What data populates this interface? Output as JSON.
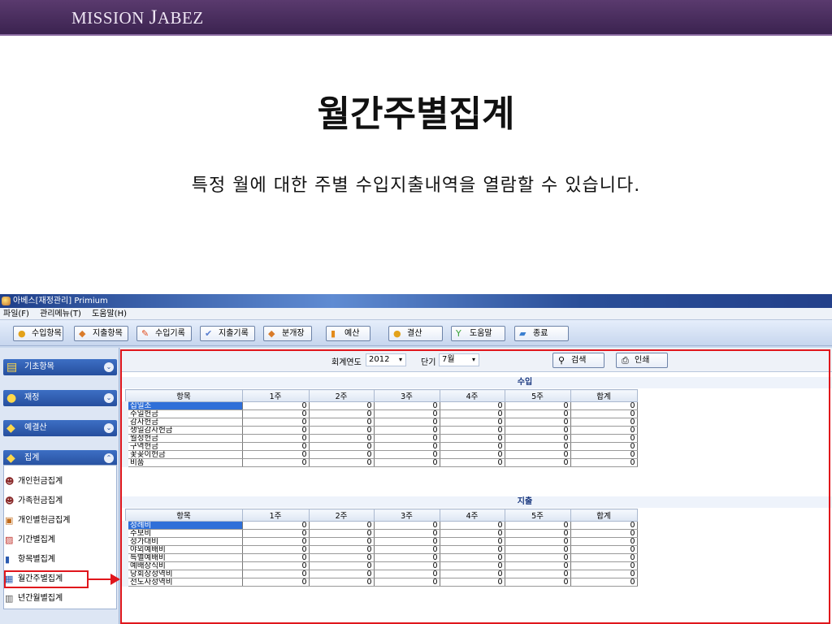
{
  "slide": {
    "brand_first": "MISSION ",
    "brand_second": "J",
    "brand_rest": "ABEZ",
    "title": "월간주별집계",
    "subtitle": "특정 월에 대한 주별 수입지출내역을 열람할 수 있습니다."
  },
  "app": {
    "title": "아베스[재정관리]  Primium",
    "menu": [
      "파일(F)",
      "관리메뉴(T)",
      "도움말(H)"
    ],
    "toolbar": [
      {
        "label": "수입항목",
        "icon": "coins-icon"
      },
      {
        "label": "지출항목",
        "icon": "diamond-icon"
      },
      {
        "label": "수입기록",
        "icon": "pencil-icon"
      },
      {
        "label": "지출기록",
        "icon": "checkmark-icon"
      },
      {
        "label": "분개장",
        "icon": "diamond-icon"
      },
      {
        "label": "예산",
        "icon": "bar-chart-icon"
      },
      {
        "label": "결산",
        "icon": "coins-icon"
      },
      {
        "label": "도움말",
        "icon": "sprout-icon"
      },
      {
        "label": "종료",
        "icon": "exit-icon"
      }
    ],
    "sidebar": {
      "headers": [
        {
          "label": "기초항목"
        },
        {
          "label": "재정"
        },
        {
          "label": "예결산"
        },
        {
          "label": "집계"
        }
      ],
      "items": [
        {
          "label": "개인헌금집계"
        },
        {
          "label": "가족헌금집계"
        },
        {
          "label": "개인별헌금집계"
        },
        {
          "label": "기간별집계"
        },
        {
          "label": "항목별집계"
        },
        {
          "label": "월간주별집계"
        },
        {
          "label": "년간월별집계"
        }
      ]
    },
    "filter": {
      "year_label": "회계연도",
      "year_value": "2012",
      "month_label": "단기",
      "month_value": "7월",
      "search_label": "검색",
      "print_label": "인쇄"
    },
    "income": {
      "title": "수입",
      "headers": [
        "항목",
        "1주",
        "2주",
        "3주",
        "4주",
        "5주",
        "합계"
      ],
      "rows": [
        {
          "name": "십일조",
          "values": [
            "0",
            "0",
            "0",
            "0",
            "0",
            "0"
          ]
        },
        {
          "name": "주일헌금",
          "values": [
            "0",
            "0",
            "0",
            "0",
            "0",
            "0"
          ]
        },
        {
          "name": "감사헌금",
          "values": [
            "0",
            "0",
            "0",
            "0",
            "0",
            "0"
          ]
        },
        {
          "name": "생일감사헌금",
          "values": [
            "0",
            "0",
            "0",
            "0",
            "0",
            "0"
          ]
        },
        {
          "name": "월정헌금",
          "values": [
            "0",
            "0",
            "0",
            "0",
            "0",
            "0"
          ]
        },
        {
          "name": "구역헌금",
          "values": [
            "0",
            "0",
            "0",
            "0",
            "0",
            "0"
          ]
        },
        {
          "name": "꽃꽂이헌금",
          "values": [
            "0",
            "0",
            "0",
            "0",
            "0",
            "0"
          ]
        },
        {
          "name": "비품",
          "values": [
            "0",
            "0",
            "0",
            "0",
            "0",
            "0"
          ]
        }
      ]
    },
    "expense": {
      "title": "지출",
      "headers": [
        "항목",
        "1주",
        "2주",
        "3주",
        "4주",
        "5주",
        "합계"
      ],
      "rows": [
        {
          "name": "성례비",
          "values": [
            "0",
            "0",
            "0",
            "0",
            "0",
            "0"
          ]
        },
        {
          "name": "주보비",
          "values": [
            "0",
            "0",
            "0",
            "0",
            "0",
            "0"
          ]
        },
        {
          "name": "성가대비",
          "values": [
            "0",
            "0",
            "0",
            "0",
            "0",
            "0"
          ]
        },
        {
          "name": "야외예배비",
          "values": [
            "0",
            "0",
            "0",
            "0",
            "0",
            "0"
          ]
        },
        {
          "name": "특별예배비",
          "values": [
            "0",
            "0",
            "0",
            "0",
            "0",
            "0"
          ]
        },
        {
          "name": "예배장식비",
          "values": [
            "0",
            "0",
            "0",
            "0",
            "0",
            "0"
          ]
        },
        {
          "name": "당회장성역비",
          "values": [
            "0",
            "0",
            "0",
            "0",
            "0",
            "0"
          ]
        },
        {
          "name": "전도사성역비",
          "values": [
            "0",
            "0",
            "0",
            "0",
            "0",
            "0"
          ]
        }
      ]
    }
  }
}
